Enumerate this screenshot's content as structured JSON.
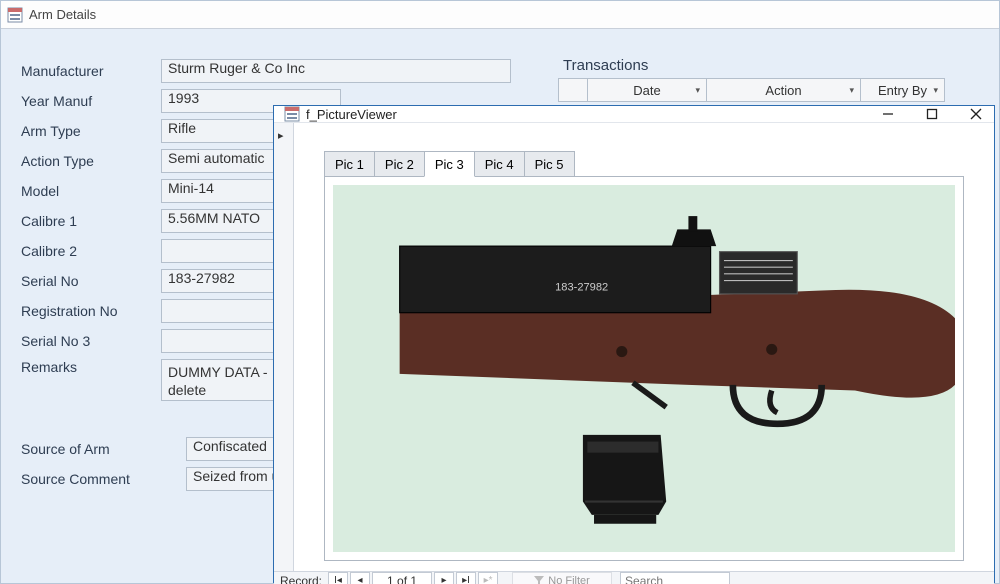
{
  "appWindow": {
    "title": "Arm Details"
  },
  "form": {
    "labels": {
      "manufacturer": "Manufacturer",
      "yearManuf": "Year Manuf",
      "armType": "Arm Type",
      "actionType": "Action Type",
      "model": "Model",
      "calibre1": "Calibre 1",
      "calibre2": "Calibre 2",
      "serialNo": "Serial No",
      "registrationNo": "Registration No",
      "serialNo3": "Serial No 3",
      "remarks": "Remarks",
      "sourceOfArm": "Source of Arm",
      "sourceComment": "Source Comment"
    },
    "values": {
      "manufacturer": "Sturm Ruger & Co Inc",
      "yearManuf": "1993",
      "armType": "Rifle",
      "actionType": "Semi automatic",
      "model": "Mini-14",
      "calibre1": "5.56MM NATO",
      "calibre2": "",
      "serialNo": "183-27982",
      "registrationNo": "",
      "serialNo3": "",
      "remarks": "DUMMY DATA -\ndelete",
      "sourceOfArm": "Confiscated",
      "sourceComment": "Seized from unlic"
    }
  },
  "transactions": {
    "title": "Transactions",
    "columns": [
      "Date",
      "Action",
      "Entry By"
    ]
  },
  "pictureViewer": {
    "title": "f_PictureViewer",
    "tabs": [
      "Pic 1",
      "Pic 2",
      "Pic 3",
      "Pic 4",
      "Pic 5"
    ],
    "activeTabIndex": 2,
    "record": {
      "label": "Record:",
      "position": "1 of 1",
      "filterLabel": "No Filter",
      "searchPlaceholder": "Search"
    }
  }
}
